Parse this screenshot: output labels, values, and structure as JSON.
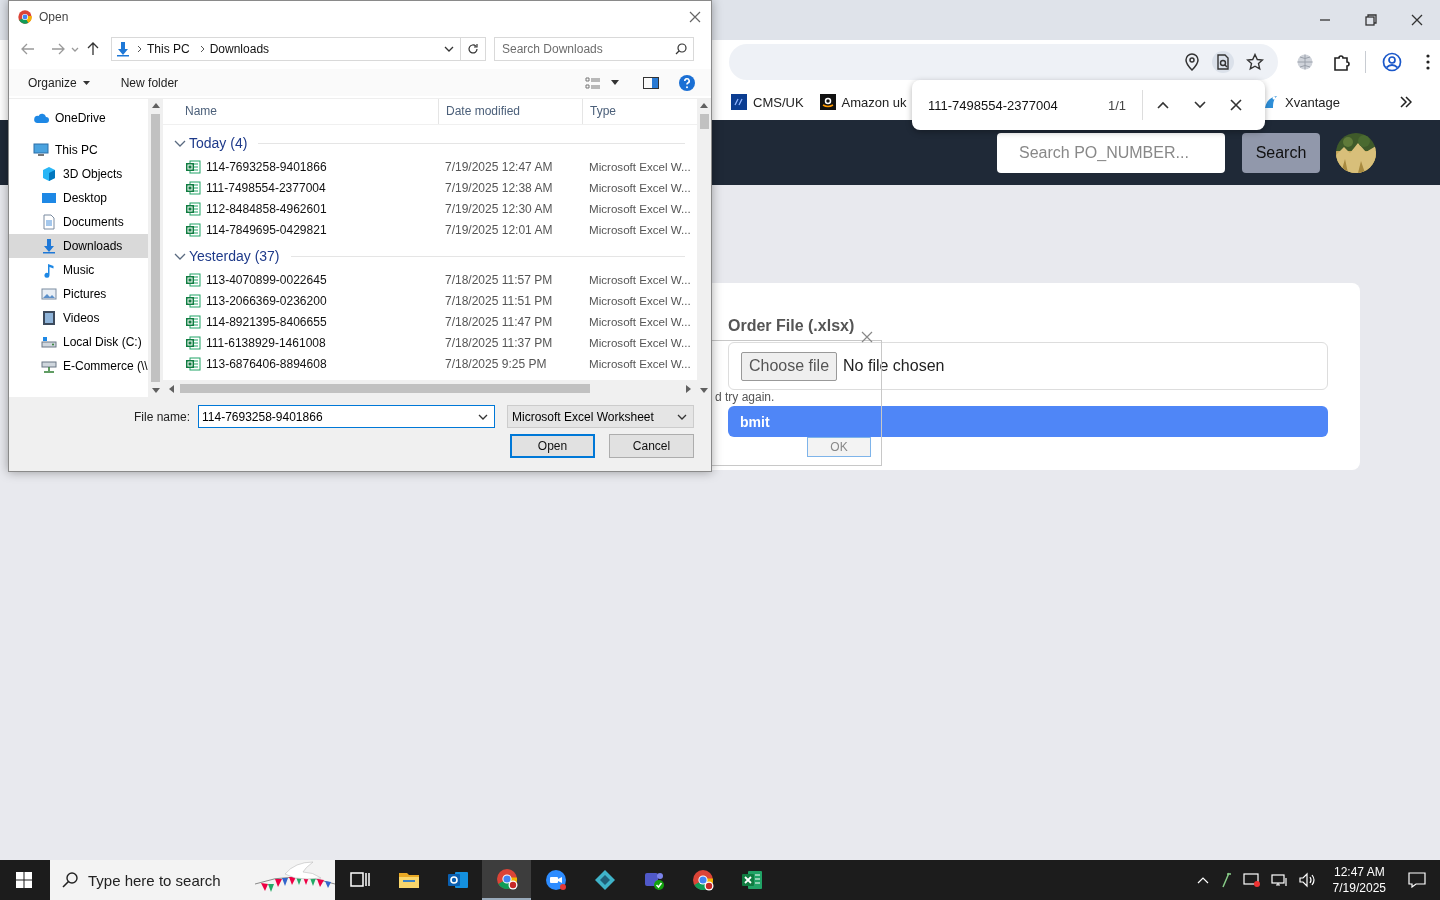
{
  "browser": {
    "bookmarks": [
      {
        "label": "CMS/UK",
        "kind": "df"
      },
      {
        "label": "Amazon uk",
        "kind": "amazon"
      },
      {
        "label": "Xvantage",
        "kind": "xvantage"
      }
    ],
    "find_bar": {
      "query": "111-7498554-2377004",
      "count": "1/1"
    }
  },
  "site": {
    "search": {
      "placeholder": "Search PO_NUMBER..."
    },
    "search_button": "Search",
    "upload": {
      "label": "Order File (.xlsx)",
      "choose_button": "Choose file",
      "file_status": "No file chosen",
      "submit_button": "bmit"
    }
  },
  "alert": {
    "message": "d try again.",
    "ok_button": "OK"
  },
  "open_dialog": {
    "title": "Open",
    "breadcrumb": [
      "This PC",
      "Downloads"
    ],
    "search": {
      "placeholder": "Search Downloads"
    },
    "toolbar": [
      "Organize",
      "New folder"
    ],
    "nav_items": [
      {
        "label": "OneDrive",
        "kind": "cloud",
        "selected": false
      },
      {
        "label": "This PC",
        "kind": "pc",
        "selected": false,
        "children": [
          {
            "label": "3D Objects",
            "kind": "cube",
            "selected": false
          },
          {
            "label": "Desktop",
            "kind": "desktop",
            "selected": false
          },
          {
            "label": "Documents",
            "kind": "document",
            "selected": false
          },
          {
            "label": "Downloads",
            "kind": "download",
            "selected": true
          },
          {
            "label": "Music",
            "kind": "music",
            "selected": false
          },
          {
            "label": "Pictures",
            "kind": "picture",
            "selected": false
          },
          {
            "label": "Videos",
            "kind": "video",
            "selected": false
          },
          {
            "label": "Local Disk (C:)",
            "kind": "disk",
            "selected": false
          },
          {
            "label": "E-Commerce (\\\\",
            "kind": "netdrive",
            "selected": false
          }
        ]
      }
    ],
    "columns": [
      "Name",
      "Date modified",
      "Type"
    ],
    "groups": [
      {
        "label": "Today (4)",
        "expanded": true,
        "files": [
          {
            "name": "114-7693258-9401866",
            "modified": "7/19/2025 12:47 AM",
            "type": "Microsoft Excel W..."
          },
          {
            "name": "111-7498554-2377004",
            "modified": "7/19/2025 12:38 AM",
            "type": "Microsoft Excel W..."
          },
          {
            "name": "112-8484858-4962601",
            "modified": "7/19/2025 12:30 AM",
            "type": "Microsoft Excel W..."
          },
          {
            "name": "114-7849695-0429821",
            "modified": "7/19/2025 12:01 AM",
            "type": "Microsoft Excel W..."
          }
        ]
      },
      {
        "label": "Yesterday (37)",
        "expanded": true,
        "files": [
          {
            "name": "113-4070899-0022645",
            "modified": "7/18/2025 11:57 PM",
            "type": "Microsoft Excel W..."
          },
          {
            "name": "113-2066369-0236200",
            "modified": "7/18/2025 11:51 PM",
            "type": "Microsoft Excel W..."
          },
          {
            "name": "114-8921395-8406655",
            "modified": "7/18/2025 11:47 PM",
            "type": "Microsoft Excel W..."
          },
          {
            "name": "111-6138929-1461008",
            "modified": "7/18/2025 11:37 PM",
            "type": "Microsoft Excel W..."
          },
          {
            "name": "113-6876406-8894608",
            "modified": "7/18/2025 9:25 PM",
            "type": "Microsoft Excel W..."
          }
        ]
      }
    ],
    "file_name_label": "File name:",
    "file_name": "114-7693258-9401866",
    "file_type": "Microsoft Excel Worksheet",
    "buttons": [
      "Open",
      "Cancel"
    ]
  },
  "taskbar": {
    "search": {
      "placeholder": "Type here to search"
    },
    "apps": [
      {
        "kind": "taskview",
        "selected": false
      },
      {
        "kind": "explorer",
        "selected": false
      },
      {
        "kind": "outlook",
        "selected": false
      },
      {
        "kind": "chrome",
        "selected": true
      },
      {
        "kind": "zoom",
        "selected": false
      },
      {
        "kind": "diamond",
        "selected": false
      },
      {
        "kind": "teams",
        "selected": false
      },
      {
        "kind": "chrome",
        "selected": false
      },
      {
        "kind": "excel",
        "selected": false
      }
    ],
    "time": "12:47 AM",
    "date": "7/19/2025"
  }
}
